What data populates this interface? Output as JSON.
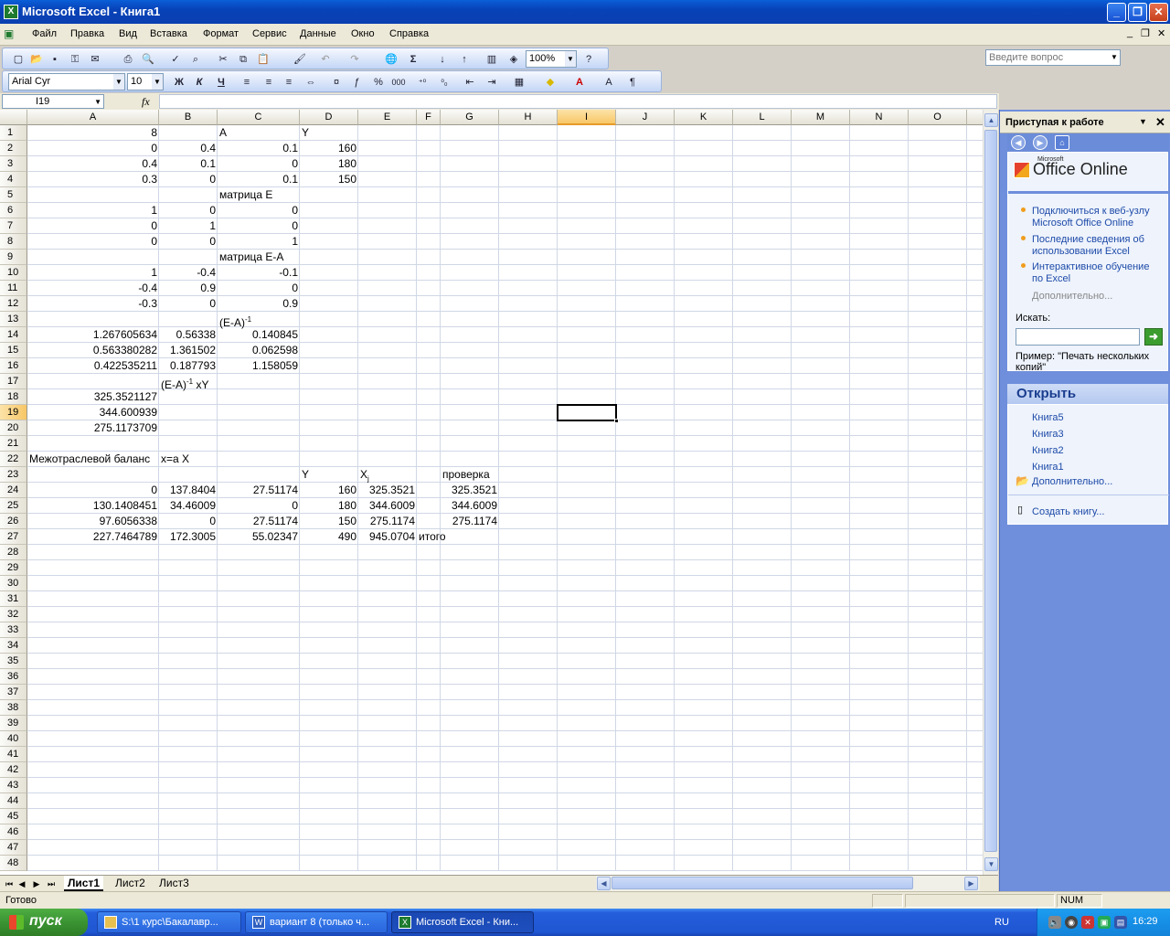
{
  "window": {
    "title": "Microsoft Excel - Книга1",
    "app_icon": "excel-icon"
  },
  "menu": {
    "items": [
      "Файл",
      "Правка",
      "Вид",
      "Вставка",
      "Формат",
      "Сервис",
      "Данные",
      "Окно",
      "Справка"
    ],
    "ask_placeholder": "Введите вопрос"
  },
  "toolbar": {
    "zoom": "100%",
    "font": "Arial Cyr",
    "size": "10",
    "bold": "Ж",
    "italic": "К",
    "underline": "Ч",
    "percent": "%",
    "thousands": "000",
    "sigma": "Σ"
  },
  "formula_bar": {
    "name_box": "I19",
    "fx": "fx",
    "content": ""
  },
  "grid": {
    "columns": [
      "A",
      "B",
      "C",
      "D",
      "E",
      "F",
      "G",
      "H",
      "I",
      "J",
      "K",
      "L",
      "M",
      "N",
      "O"
    ],
    "selected_column": "I",
    "selected_row": "19",
    "rows": [
      "1",
      "2",
      "3",
      "4",
      "5",
      "6",
      "7",
      "8",
      "9",
      "10",
      "11",
      "12",
      "13",
      "14",
      "15",
      "16",
      "17",
      "18",
      "19",
      "20",
      "21",
      "22",
      "23",
      "24",
      "25",
      "26",
      "27",
      "28",
      "29",
      "30",
      "31",
      "32",
      "33",
      "34",
      "35",
      "36",
      "37",
      "38",
      "39",
      "40",
      "41",
      "42",
      "43",
      "44",
      "45",
      "46",
      "47",
      "48"
    ],
    "cells": [
      {
        "row": 1,
        "col": "A",
        "v": "8",
        "align": "r"
      },
      {
        "row": 1,
        "col": "C",
        "v": "A"
      },
      {
        "row": 1,
        "col": "D",
        "v": "Y"
      },
      {
        "row": 2,
        "col": "A",
        "v": "0",
        "align": "r"
      },
      {
        "row": 2,
        "col": "B",
        "v": "0.4",
        "align": "r"
      },
      {
        "row": 2,
        "col": "C",
        "v": "0.1",
        "align": "r"
      },
      {
        "row": 2,
        "col": "D",
        "v": "160",
        "align": "r"
      },
      {
        "row": 3,
        "col": "A",
        "v": "0.4",
        "align": "r"
      },
      {
        "row": 3,
        "col": "B",
        "v": "0.1",
        "align": "r"
      },
      {
        "row": 3,
        "col": "C",
        "v": "0",
        "align": "r"
      },
      {
        "row": 3,
        "col": "D",
        "v": "180",
        "align": "r"
      },
      {
        "row": 4,
        "col": "A",
        "v": "0.3",
        "align": "r"
      },
      {
        "row": 4,
        "col": "B",
        "v": "0",
        "align": "r"
      },
      {
        "row": 4,
        "col": "C",
        "v": "0.1",
        "align": "r"
      },
      {
        "row": 4,
        "col": "D",
        "v": "150",
        "align": "r"
      },
      {
        "row": 5,
        "col": "C",
        "v": "матрица Е"
      },
      {
        "row": 6,
        "col": "A",
        "v": "1",
        "align": "r"
      },
      {
        "row": 6,
        "col": "B",
        "v": "0",
        "align": "r"
      },
      {
        "row": 6,
        "col": "C",
        "v": "0",
        "align": "r"
      },
      {
        "row": 7,
        "col": "A",
        "v": "0",
        "align": "r"
      },
      {
        "row": 7,
        "col": "B",
        "v": "1",
        "align": "r"
      },
      {
        "row": 7,
        "col": "C",
        "v": "0",
        "align": "r"
      },
      {
        "row": 8,
        "col": "A",
        "v": "0",
        "align": "r"
      },
      {
        "row": 8,
        "col": "B",
        "v": "0",
        "align": "r"
      },
      {
        "row": 8,
        "col": "C",
        "v": "1",
        "align": "r"
      },
      {
        "row": 9,
        "col": "C",
        "v": "матрица Е-А"
      },
      {
        "row": 10,
        "col": "A",
        "v": "1",
        "align": "r"
      },
      {
        "row": 10,
        "col": "B",
        "v": "-0.4",
        "align": "r"
      },
      {
        "row": 10,
        "col": "C",
        "v": "-0.1",
        "align": "r"
      },
      {
        "row": 11,
        "col": "A",
        "v": "-0.4",
        "align": "r"
      },
      {
        "row": 11,
        "col": "B",
        "v": "0.9",
        "align": "r"
      },
      {
        "row": 11,
        "col": "C",
        "v": "0",
        "align": "r"
      },
      {
        "row": 12,
        "col": "A",
        "v": "-0.3",
        "align": "r"
      },
      {
        "row": 12,
        "col": "B",
        "v": "0",
        "align": "r"
      },
      {
        "row": 12,
        "col": "C",
        "v": "0.9",
        "align": "r"
      },
      {
        "row": 13,
        "col": "C",
        "v": "(E-A)",
        "sup": "-1"
      },
      {
        "row": 14,
        "col": "A",
        "v": "1.267605634",
        "align": "r"
      },
      {
        "row": 14,
        "col": "B",
        "v": "0.56338",
        "align": "r"
      },
      {
        "row": 14,
        "col": "C",
        "v": "0.140845",
        "align": "r"
      },
      {
        "row": 15,
        "col": "A",
        "v": "0.563380282",
        "align": "r"
      },
      {
        "row": 15,
        "col": "B",
        "v": "1.361502",
        "align": "r"
      },
      {
        "row": 15,
        "col": "C",
        "v": "0.062598",
        "align": "r"
      },
      {
        "row": 16,
        "col": "A",
        "v": "0.422535211",
        "align": "r"
      },
      {
        "row": 16,
        "col": "B",
        "v": "0.187793",
        "align": "r"
      },
      {
        "row": 16,
        "col": "C",
        "v": "1.158059",
        "align": "r"
      },
      {
        "row": 17,
        "col": "B",
        "v": "(E-A)",
        "sup": "-1",
        "tail": " xY"
      },
      {
        "row": 18,
        "col": "A",
        "v": "325.3521127",
        "align": "r"
      },
      {
        "row": 19,
        "col": "A",
        "v": "344.600939",
        "align": "r"
      },
      {
        "row": 20,
        "col": "A",
        "v": "275.1173709",
        "align": "r"
      },
      {
        "row": 22,
        "col": "A",
        "v": "Межотраслевой баланс"
      },
      {
        "row": 22,
        "col": "B",
        "v": "x=a X"
      },
      {
        "row": 23,
        "col": "D",
        "v": "Y"
      },
      {
        "row": 23,
        "col": "E",
        "v": "X",
        "sub": "j"
      },
      {
        "row": 23,
        "col": "G",
        "v": "проверка"
      },
      {
        "row": 24,
        "col": "A",
        "v": "0",
        "align": "r"
      },
      {
        "row": 24,
        "col": "B",
        "v": "137.8404",
        "align": "r"
      },
      {
        "row": 24,
        "col": "C",
        "v": "27.51174",
        "align": "r"
      },
      {
        "row": 24,
        "col": "D",
        "v": "160",
        "align": "r"
      },
      {
        "row": 24,
        "col": "E",
        "v": "325.3521",
        "align": "r"
      },
      {
        "row": 24,
        "col": "G",
        "v": "325.3521",
        "align": "r"
      },
      {
        "row": 25,
        "col": "A",
        "v": "130.1408451",
        "align": "r"
      },
      {
        "row": 25,
        "col": "B",
        "v": "34.46009",
        "align": "r"
      },
      {
        "row": 25,
        "col": "C",
        "v": "0",
        "align": "r"
      },
      {
        "row": 25,
        "col": "D",
        "v": "180",
        "align": "r"
      },
      {
        "row": 25,
        "col": "E",
        "v": "344.6009",
        "align": "r"
      },
      {
        "row": 25,
        "col": "G",
        "v": "344.6009",
        "align": "r"
      },
      {
        "row": 26,
        "col": "A",
        "v": "97.6056338",
        "align": "r"
      },
      {
        "row": 26,
        "col": "B",
        "v": "0",
        "align": "r"
      },
      {
        "row": 26,
        "col": "C",
        "v": "27.51174",
        "align": "r"
      },
      {
        "row": 26,
        "col": "D",
        "v": "150",
        "align": "r"
      },
      {
        "row": 26,
        "col": "E",
        "v": "275.1174",
        "align": "r"
      },
      {
        "row": 26,
        "col": "G",
        "v": "275.1174",
        "align": "r"
      },
      {
        "row": 27,
        "col": "A",
        "v": "227.7464789",
        "align": "r"
      },
      {
        "row": 27,
        "col": "B",
        "v": "172.3005",
        "align": "r"
      },
      {
        "row": 27,
        "col": "C",
        "v": "55.02347",
        "align": "r"
      },
      {
        "row": 27,
        "col": "D",
        "v": "490",
        "align": "r"
      },
      {
        "row": 27,
        "col": "E",
        "v": "945.0704",
        "align": "r"
      },
      {
        "row": 27,
        "col": "F",
        "v": "итого"
      }
    ]
  },
  "sheets": {
    "tabs": [
      "Лист1",
      "Лист2",
      "Лист3"
    ],
    "active": "Лист1"
  },
  "task_pane": {
    "title": "Приступая к работе",
    "logo_small": "Microsoft",
    "logo": "Office Online",
    "links": [
      "Подключиться к веб-узлу Microsoft Office Online",
      "Последние сведения об использовании Excel",
      "Интерактивное обучение по Excel"
    ],
    "more": "Дополнительно...",
    "search_label": "Искать:",
    "example": "Пример:  \"Печать нескольких копий\"",
    "open_title": "Открыть",
    "open_files": [
      "Книга5",
      "Книга3",
      "Книга2",
      "Книга1"
    ],
    "open_more": "Дополнительно...",
    "create": "Создать книгу..."
  },
  "status": {
    "text": "Готово",
    "num": "NUM"
  },
  "taskbar": {
    "start": "пуск",
    "tasks": [
      "S:\\1 курс\\Бакалавр...",
      "вариант 8 (только ч...",
      "Microsoft Excel - Кни..."
    ],
    "lang": "RU",
    "clock": "16:29"
  }
}
